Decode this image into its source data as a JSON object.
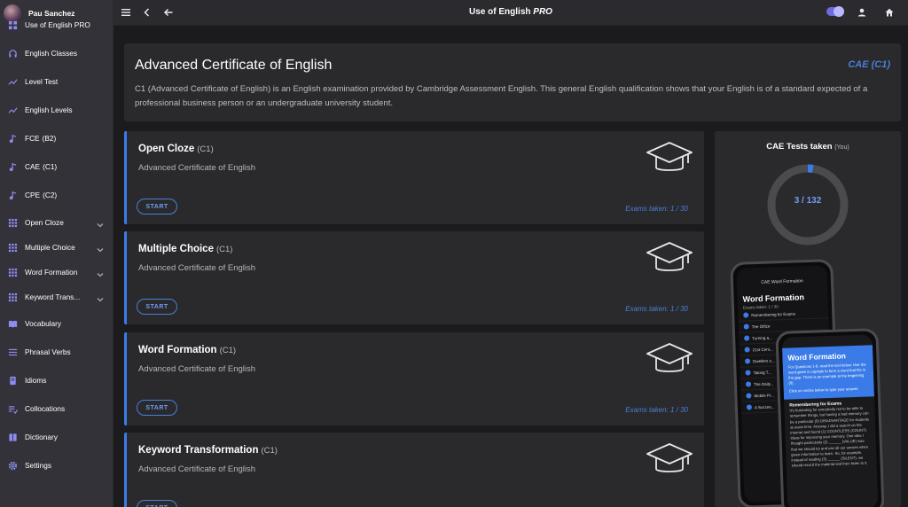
{
  "user": {
    "name": "Pau Sanchez"
  },
  "sidebar": {
    "items": [
      {
        "label": "Use of English PRO",
        "level": "",
        "icon": "grid-icon",
        "expand": false
      },
      {
        "label": "English Classes",
        "level": "",
        "icon": "headphones-icon",
        "expand": false
      },
      {
        "label": "Level Test",
        "level": "",
        "icon": "trend-icon",
        "expand": false
      },
      {
        "label": "English Levels",
        "level": "",
        "icon": "trend-icon",
        "expand": false
      },
      {
        "label": "FCE",
        "level": "(B2)",
        "icon": "music-note-icon",
        "expand": false
      },
      {
        "label": "CAE",
        "level": "(C1)",
        "icon": "music-note-icon",
        "expand": false
      },
      {
        "label": "CPE",
        "level": "(C2)",
        "icon": "music-note-icon",
        "expand": false
      },
      {
        "label": "Open Cloze",
        "level": "",
        "icon": "apps-icon",
        "expand": true
      },
      {
        "label": "Multiple Choice",
        "level": "",
        "icon": "apps-icon",
        "expand": true
      },
      {
        "label": "Word Formation",
        "level": "",
        "icon": "apps-icon",
        "expand": true
      },
      {
        "label": "Keyword Trans...",
        "level": "",
        "icon": "apps-icon",
        "expand": true
      },
      {
        "label": "Vocabulary",
        "level": "",
        "icon": "book-icon",
        "expand": false
      },
      {
        "label": "Phrasal Verbs",
        "level": "",
        "icon": "list-icon",
        "expand": false
      },
      {
        "label": "Idioms",
        "level": "",
        "icon": "page-icon",
        "expand": false
      },
      {
        "label": "Collocations",
        "level": "",
        "icon": "playlist-icon",
        "expand": false
      },
      {
        "label": "Dictionary",
        "level": "",
        "icon": "dictionary-icon",
        "expand": false
      },
      {
        "label": "Settings",
        "level": "",
        "icon": "gear-icon",
        "expand": false
      }
    ]
  },
  "topbar": {
    "title": "Use of English",
    "title_suffix": "PRO"
  },
  "hero": {
    "title": "Advanced Certificate of English",
    "badge": "CAE (C1)",
    "description": "C1 (Advanced Certificate of English) is an English examination provided by Cambridge Assessment English. This general English qualification shows that your English is of a standard expected of a professional business person or an undergraduate university student."
  },
  "cards": [
    {
      "title": "Open Cloze",
      "level": "(C1)",
      "subtitle": "Advanced Certificate of English",
      "button": "START",
      "exams": "Exams taken: 1 / 30"
    },
    {
      "title": "Multiple Choice",
      "level": "(C1)",
      "subtitle": "Advanced Certificate of English",
      "button": "START",
      "exams": "Exams taken: 1 / 30"
    },
    {
      "title": "Word Formation",
      "level": "(C1)",
      "subtitle": "Advanced Certificate of English",
      "button": "START",
      "exams": "Exams taken: 1 / 30"
    },
    {
      "title": "Keyword Transformation",
      "level": "(C1)",
      "subtitle": "Advanced Certificate of English",
      "button": "START",
      "exams": ""
    }
  ],
  "stats": {
    "title": "CAE Tests taken",
    "title_suffix": "(You)",
    "value": "3 / 132",
    "taken": 3,
    "total": 132
  },
  "phone_back": {
    "header": "CAE Word Formation",
    "title": "Word Formation",
    "subtitle": "Exams taken: 1 / 30",
    "rows": [
      "Remembering for Exams",
      "The Office",
      "Turning a...",
      "21st Cent...",
      "Dwellers o...",
      "Taking T...",
      "The Daily...",
      "Mobile Pr...",
      "A Succes..."
    ]
  },
  "phone_front": {
    "title": "Word Formation",
    "instructions": "For Questions 1-8, read the text below. Use the word given in capitals to form a word that fits in the gap. There is an example at the beginning (0).",
    "hint": "Click on circles below to type your answer.",
    "body_title": "Remembering for Exams",
    "body": "It's frustrating for everybody not to be able to remember things, but having a bad memory can be a particular (0) DISADVANTAGE for students at exam time. Anyway, I did a search on the internet and found (1) COUNTLESS (COUNT) ideas for improving your memory. One idea I thought particularly (2) ______ (VALUE) was that we should try and use all our senses when given information to learn. So, for example, instead of reading (3) ______ (SILENT), we should record the material and then listen to it."
  }
}
